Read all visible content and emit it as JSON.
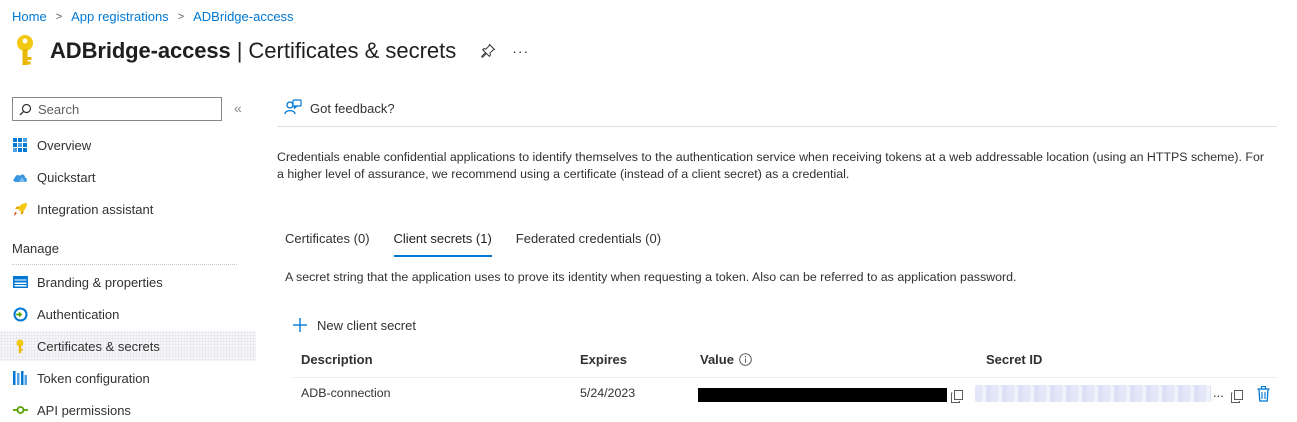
{
  "breadcrumb": {
    "items": [
      "Home",
      "App registrations",
      "ADBridge-access"
    ],
    "separator": ">"
  },
  "header": {
    "app_name": "ADBridge-access",
    "separator": "|",
    "page_name": "Certificates & secrets",
    "more": "···"
  },
  "sidebar": {
    "search_placeholder": "Search",
    "collapse": "«",
    "items": [
      {
        "label": "Overview",
        "icon": "grid-icon"
      },
      {
        "label": "Quickstart",
        "icon": "cloud-icon"
      },
      {
        "label": "Integration assistant",
        "icon": "rocket-icon"
      }
    ],
    "section_label": "Manage",
    "manage_items": [
      {
        "label": "Branding & properties",
        "icon": "branding-icon"
      },
      {
        "label": "Authentication",
        "icon": "authentication-icon"
      },
      {
        "label": "Certificates & secrets",
        "icon": "key-icon",
        "active": true
      },
      {
        "label": "Token configuration",
        "icon": "token-bars-icon"
      },
      {
        "label": "API permissions",
        "icon": "api-permissions-icon"
      }
    ]
  },
  "feedback": {
    "label": "Got feedback?"
  },
  "description": "Credentials enable confidential applications to identify themselves to the authentication service when receiving tokens at a web addressable location (using an HTTPS scheme). For a higher level of assurance, we recommend using a certificate (instead of a client secret) as a credential.",
  "tabs": [
    {
      "label": "Certificates (0)",
      "active": false
    },
    {
      "label": "Client secrets (1)",
      "active": true
    },
    {
      "label": "Federated credentials (0)",
      "active": false
    }
  ],
  "tab_description": "A secret string that the application uses to prove its identity when requesting a token. Also can be referred to as application password.",
  "new_secret_label": "New client secret",
  "table": {
    "columns": [
      "Description",
      "Expires",
      "Value",
      "Secret ID"
    ],
    "rows": [
      {
        "description": "ADB-connection",
        "expires": "5/24/2023",
        "value": "",
        "secret_id_suffix": "..."
      }
    ]
  },
  "colors": {
    "link": "#0078d4",
    "key_icon": "#f2c811",
    "delete_icon": "#0078d4"
  }
}
